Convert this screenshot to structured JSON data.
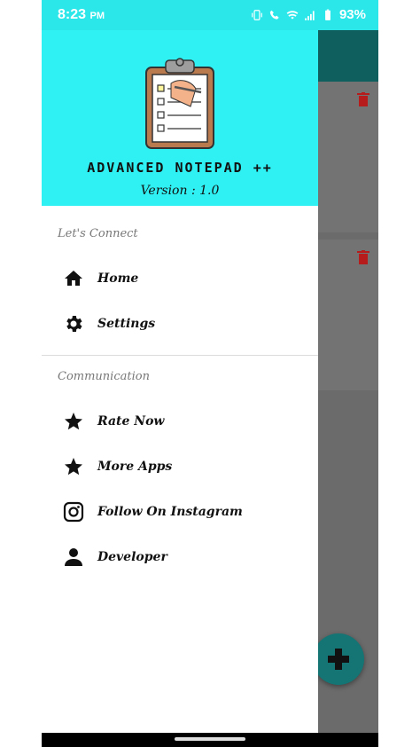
{
  "status_bar": {
    "time": "8:23",
    "ampm": "PM",
    "battery": "93%",
    "icons": [
      "vibrate-icon",
      "wifi-call-icon",
      "wifi-icon",
      "signal-icon",
      "battery-icon"
    ]
  },
  "drawer": {
    "app_title": "ADVANCED NOTEPAD ++",
    "version": "Version : 1.0",
    "sections": [
      {
        "label": "Let's Connect",
        "items": [
          {
            "label": "Home",
            "icon": "home-icon"
          },
          {
            "label": "Settings",
            "icon": "gear-icon"
          }
        ]
      },
      {
        "label": "Communication",
        "items": [
          {
            "label": "Rate Now",
            "icon": "star-icon"
          },
          {
            "label": "More Apps",
            "icon": "star-icon"
          },
          {
            "label": "Follow On Instagram",
            "icon": "instagram-icon"
          },
          {
            "label": "Developer",
            "icon": "person-icon"
          }
        ]
      }
    ]
  },
  "colors": {
    "header_bg": "#2ff0f2",
    "status_bg": "#2be7ea",
    "toolbar_bg": "#0f5f5e",
    "fab_bg": "#157575",
    "scrim": "#6b6b6b",
    "trash": "#b71c1c"
  }
}
